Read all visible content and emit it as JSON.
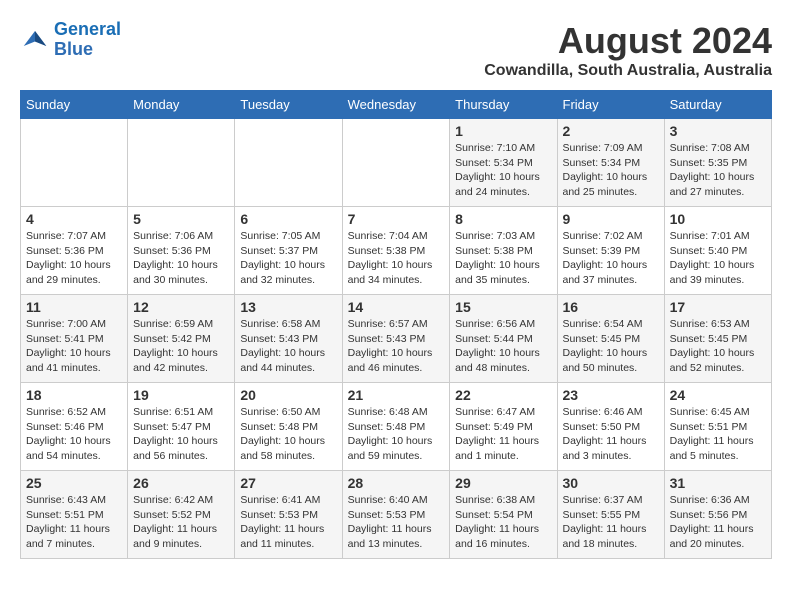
{
  "logo": {
    "text_general": "General",
    "text_blue": "Blue"
  },
  "title": {
    "month_year": "August 2024",
    "location": "Cowandilla, South Australia, Australia"
  },
  "weekdays": [
    "Sunday",
    "Monday",
    "Tuesday",
    "Wednesday",
    "Thursday",
    "Friday",
    "Saturday"
  ],
  "weeks": [
    [
      {
        "day": "",
        "info": ""
      },
      {
        "day": "",
        "info": ""
      },
      {
        "day": "",
        "info": ""
      },
      {
        "day": "",
        "info": ""
      },
      {
        "day": "1",
        "info": "Sunrise: 7:10 AM\nSunset: 5:34 PM\nDaylight: 10 hours\nand 24 minutes."
      },
      {
        "day": "2",
        "info": "Sunrise: 7:09 AM\nSunset: 5:34 PM\nDaylight: 10 hours\nand 25 minutes."
      },
      {
        "day": "3",
        "info": "Sunrise: 7:08 AM\nSunset: 5:35 PM\nDaylight: 10 hours\nand 27 minutes."
      }
    ],
    [
      {
        "day": "4",
        "info": "Sunrise: 7:07 AM\nSunset: 5:36 PM\nDaylight: 10 hours\nand 29 minutes."
      },
      {
        "day": "5",
        "info": "Sunrise: 7:06 AM\nSunset: 5:36 PM\nDaylight: 10 hours\nand 30 minutes."
      },
      {
        "day": "6",
        "info": "Sunrise: 7:05 AM\nSunset: 5:37 PM\nDaylight: 10 hours\nand 32 minutes."
      },
      {
        "day": "7",
        "info": "Sunrise: 7:04 AM\nSunset: 5:38 PM\nDaylight: 10 hours\nand 34 minutes."
      },
      {
        "day": "8",
        "info": "Sunrise: 7:03 AM\nSunset: 5:38 PM\nDaylight: 10 hours\nand 35 minutes."
      },
      {
        "day": "9",
        "info": "Sunrise: 7:02 AM\nSunset: 5:39 PM\nDaylight: 10 hours\nand 37 minutes."
      },
      {
        "day": "10",
        "info": "Sunrise: 7:01 AM\nSunset: 5:40 PM\nDaylight: 10 hours\nand 39 minutes."
      }
    ],
    [
      {
        "day": "11",
        "info": "Sunrise: 7:00 AM\nSunset: 5:41 PM\nDaylight: 10 hours\nand 41 minutes."
      },
      {
        "day": "12",
        "info": "Sunrise: 6:59 AM\nSunset: 5:42 PM\nDaylight: 10 hours\nand 42 minutes."
      },
      {
        "day": "13",
        "info": "Sunrise: 6:58 AM\nSunset: 5:43 PM\nDaylight: 10 hours\nand 44 minutes."
      },
      {
        "day": "14",
        "info": "Sunrise: 6:57 AM\nSunset: 5:43 PM\nDaylight: 10 hours\nand 46 minutes."
      },
      {
        "day": "15",
        "info": "Sunrise: 6:56 AM\nSunset: 5:44 PM\nDaylight: 10 hours\nand 48 minutes."
      },
      {
        "day": "16",
        "info": "Sunrise: 6:54 AM\nSunset: 5:45 PM\nDaylight: 10 hours\nand 50 minutes."
      },
      {
        "day": "17",
        "info": "Sunrise: 6:53 AM\nSunset: 5:45 PM\nDaylight: 10 hours\nand 52 minutes."
      }
    ],
    [
      {
        "day": "18",
        "info": "Sunrise: 6:52 AM\nSunset: 5:46 PM\nDaylight: 10 hours\nand 54 minutes."
      },
      {
        "day": "19",
        "info": "Sunrise: 6:51 AM\nSunset: 5:47 PM\nDaylight: 10 hours\nand 56 minutes."
      },
      {
        "day": "20",
        "info": "Sunrise: 6:50 AM\nSunset: 5:48 PM\nDaylight: 10 hours\nand 58 minutes."
      },
      {
        "day": "21",
        "info": "Sunrise: 6:48 AM\nSunset: 5:48 PM\nDaylight: 10 hours\nand 59 minutes."
      },
      {
        "day": "22",
        "info": "Sunrise: 6:47 AM\nSunset: 5:49 PM\nDaylight: 11 hours\nand 1 minute."
      },
      {
        "day": "23",
        "info": "Sunrise: 6:46 AM\nSunset: 5:50 PM\nDaylight: 11 hours\nand 3 minutes."
      },
      {
        "day": "24",
        "info": "Sunrise: 6:45 AM\nSunset: 5:51 PM\nDaylight: 11 hours\nand 5 minutes."
      }
    ],
    [
      {
        "day": "25",
        "info": "Sunrise: 6:43 AM\nSunset: 5:51 PM\nDaylight: 11 hours\nand 7 minutes."
      },
      {
        "day": "26",
        "info": "Sunrise: 6:42 AM\nSunset: 5:52 PM\nDaylight: 11 hours\nand 9 minutes."
      },
      {
        "day": "27",
        "info": "Sunrise: 6:41 AM\nSunset: 5:53 PM\nDaylight: 11 hours\nand 11 minutes."
      },
      {
        "day": "28",
        "info": "Sunrise: 6:40 AM\nSunset: 5:53 PM\nDaylight: 11 hours\nand 13 minutes."
      },
      {
        "day": "29",
        "info": "Sunrise: 6:38 AM\nSunset: 5:54 PM\nDaylight: 11 hours\nand 16 minutes."
      },
      {
        "day": "30",
        "info": "Sunrise: 6:37 AM\nSunset: 5:55 PM\nDaylight: 11 hours\nand 18 minutes."
      },
      {
        "day": "31",
        "info": "Sunrise: 6:36 AM\nSunset: 5:56 PM\nDaylight: 11 hours\nand 20 minutes."
      }
    ]
  ]
}
